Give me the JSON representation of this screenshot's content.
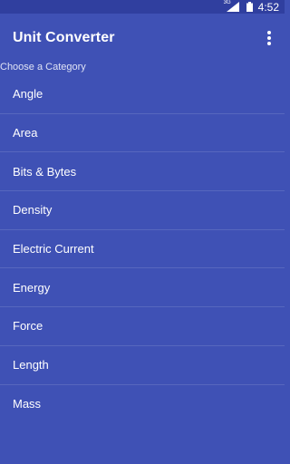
{
  "status_bar": {
    "network_label": "3G",
    "time": "4:52"
  },
  "app_bar": {
    "title": "Unit Converter",
    "overflow_icon": "more-vert-icon"
  },
  "section_label": "Choose a Category",
  "categories": [
    {
      "label": "Angle"
    },
    {
      "label": "Area"
    },
    {
      "label": "Bits & Bytes"
    },
    {
      "label": "Density"
    },
    {
      "label": "Electric Current"
    },
    {
      "label": "Energy"
    },
    {
      "label": "Force"
    },
    {
      "label": "Length"
    },
    {
      "label": "Mass"
    }
  ],
  "colors": {
    "primary": "#3f51b5",
    "status_bar": "#303f9f",
    "text": "#ffffff"
  }
}
